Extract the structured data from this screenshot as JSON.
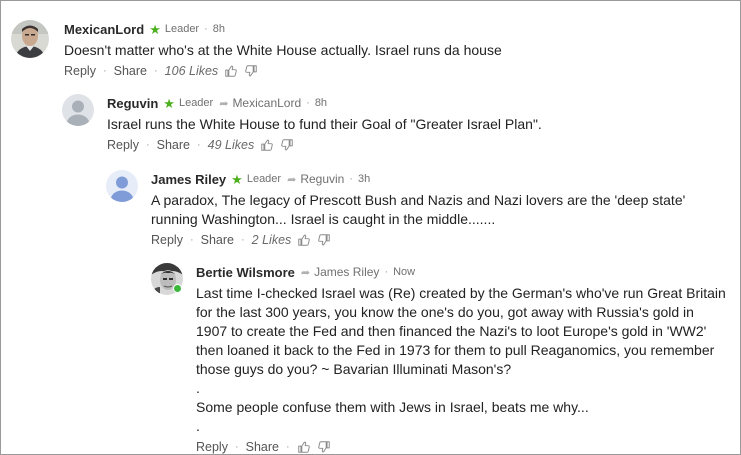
{
  "comments": [
    {
      "author": "MexicanLord",
      "badge": "Leader",
      "reply_to": "",
      "time": "8h",
      "lines": [
        "Doesn't matter who's at the White House actually. Israel runs da house"
      ],
      "reply_label": "Reply",
      "share_label": "Share",
      "likes": "106 Likes",
      "avatar": "photo-man"
    },
    {
      "author": "Reguvin",
      "badge": "Leader",
      "reply_to": "MexicanLord",
      "time": "8h",
      "lines": [
        "Israel runs the White House to fund their Goal of \"Greater Israel Plan\"."
      ],
      "reply_label": "Reply",
      "share_label": "Share",
      "likes": "49 Likes",
      "avatar": "default-grey"
    },
    {
      "author": "James Riley",
      "badge": "Leader",
      "reply_to": "Reguvin",
      "time": "3h",
      "lines": [
        "A paradox, The legacy of Prescott Bush and Nazis and Nazi lovers are the 'deep state'",
        "running Washington... Israel is caught in the middle......."
      ],
      "reply_label": "Reply",
      "share_label": "Share",
      "likes": "2 Likes",
      "avatar": "default-blue"
    },
    {
      "author": "Bertie Wilsmore",
      "badge": "",
      "reply_to": "James Riley",
      "time": "Now",
      "lines": [
        "Last time I-checked Israel was (Re) created by the German's who've run Great Britain",
        "for the last 300 years, you know the one's do you, got away with Russia's gold in",
        "1907 to create the Fed and then financed the Nazi's to loot Europe's gold in 'WW2'",
        "then loaned it back to the Fed in 1973 for them to pull Reaganomics, you remember",
        "those guys do you? ~ Bavarian Illuminati Mason's?",
        ".",
        "Some people confuse them with Jews in Israel, beats me why...",
        "."
      ],
      "reply_label": "Reply",
      "share_label": "Share",
      "likes": "",
      "avatar": "photo-bw"
    }
  ],
  "colors": {
    "star": "#4caf1d",
    "online": "#3bb83b",
    "default_grey_avatar": "#a9b0b8",
    "default_blue_avatar": "#7f9bd8"
  },
  "icons": {
    "upvote": "thumbs-up-icon",
    "downvote": "thumbs-down-icon",
    "leader": "star-icon",
    "reply_to": "reply-arrow-icon"
  }
}
